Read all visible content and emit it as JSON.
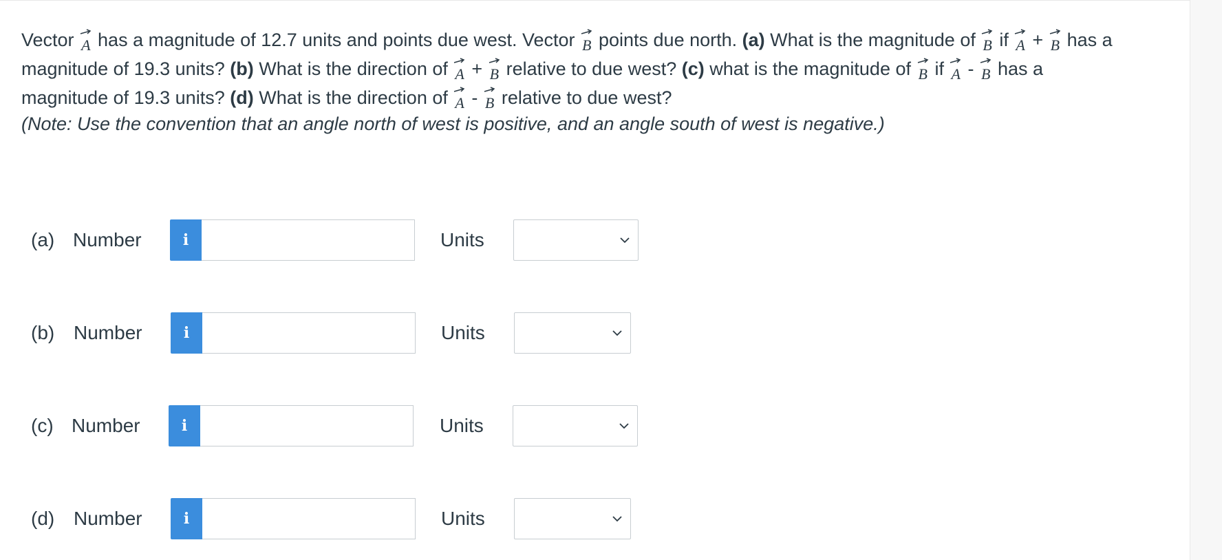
{
  "question": {
    "intro_1": "Vector",
    "vec_a": "A",
    "vec_b": "B",
    "intro_2": "has a magnitude of 12.7 units and points due west. Vector",
    "intro_3": "points due north.",
    "part_a_label": "(a)",
    "part_a_text_1": "What is the magnitude of",
    "if_word": "if",
    "plus_sign": "+",
    "minus_sign": "-",
    "has_a_word": "has a",
    "part_a_text_2": "magnitude of 19.3 units?",
    "part_b_label": "(b)",
    "part_b_text_1": "What is the direction of",
    "part_b_text_2": "relative to due west?",
    "part_c_label": "(c)",
    "part_c_text_1": "what is the magnitude of",
    "part_c_text_2": "magnitude of 19.3 units?",
    "part_d_label": "(d)",
    "part_d_text_1": "What is the direction of",
    "part_d_text_2": "relative to due west?",
    "note": "(Note: Use the convention that an angle north of west is positive, and an angle south of west is negative.)"
  },
  "answers": [
    {
      "part": "(a)",
      "number_label": "Number",
      "info_icon": "i",
      "value": "",
      "units_label": "Units",
      "units_selected": ""
    },
    {
      "part": "(b)",
      "number_label": "Number",
      "info_icon": "i",
      "value": "",
      "units_label": "Units",
      "units_selected": ""
    },
    {
      "part": "(c)",
      "number_label": "Number",
      "info_icon": "i",
      "value": "",
      "units_label": "Units",
      "units_selected": ""
    },
    {
      "part": "(d)",
      "number_label": "Number",
      "info_icon": "i",
      "value": "",
      "units_label": "Units",
      "units_selected": ""
    }
  ],
  "colors": {
    "info_button": "#3b8ddd",
    "text": "#2d3b45",
    "input_border": "#c7cdd1"
  }
}
